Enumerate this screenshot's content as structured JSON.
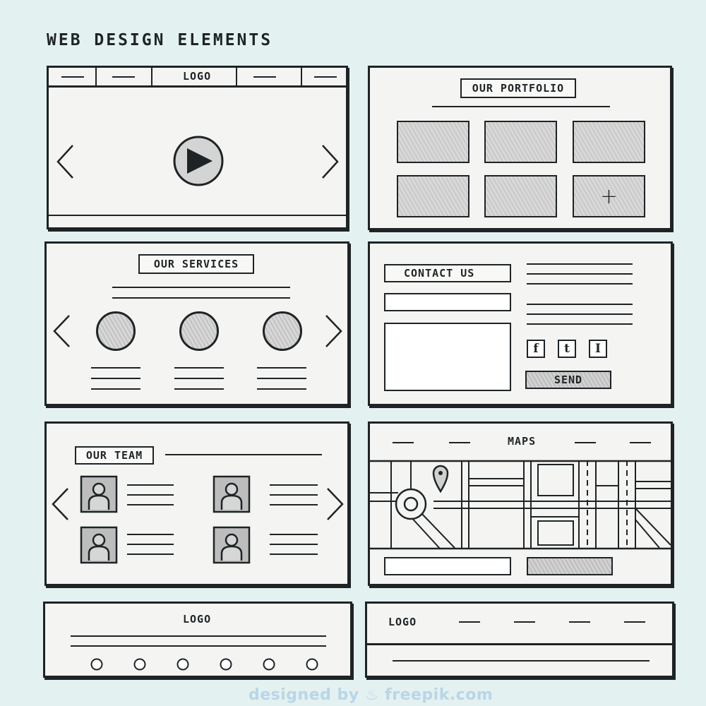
{
  "title": "WEB DESIGN ELEMENTS",
  "panels": {
    "slider": {
      "logo": "LOGO"
    },
    "portfolio": {
      "heading": "OUR PORTFOLIO",
      "plus": "+"
    },
    "services": {
      "heading": "OUR SERVICES"
    },
    "contact": {
      "heading": "CONTACT US",
      "social": [
        "f",
        "t",
        "I"
      ],
      "send_label": "SEND"
    },
    "team": {
      "heading": "OUR TEAM"
    },
    "maps": {
      "heading": "MAPS"
    },
    "footer_left": {
      "logo": "LOGO"
    },
    "footer_right": {
      "logo": "LOGO"
    }
  },
  "watermark": "designed by ♨ freepik.com",
  "colors": {
    "background": "#e4f1f1",
    "ink": "#1e2426",
    "panel": "#f4f4f2",
    "shade": "#cfcfcf"
  },
  "icons": [
    "play-icon",
    "chevron-left-icon",
    "chevron-right-icon",
    "map-pin-icon",
    "person-icon",
    "plus-icon"
  ]
}
